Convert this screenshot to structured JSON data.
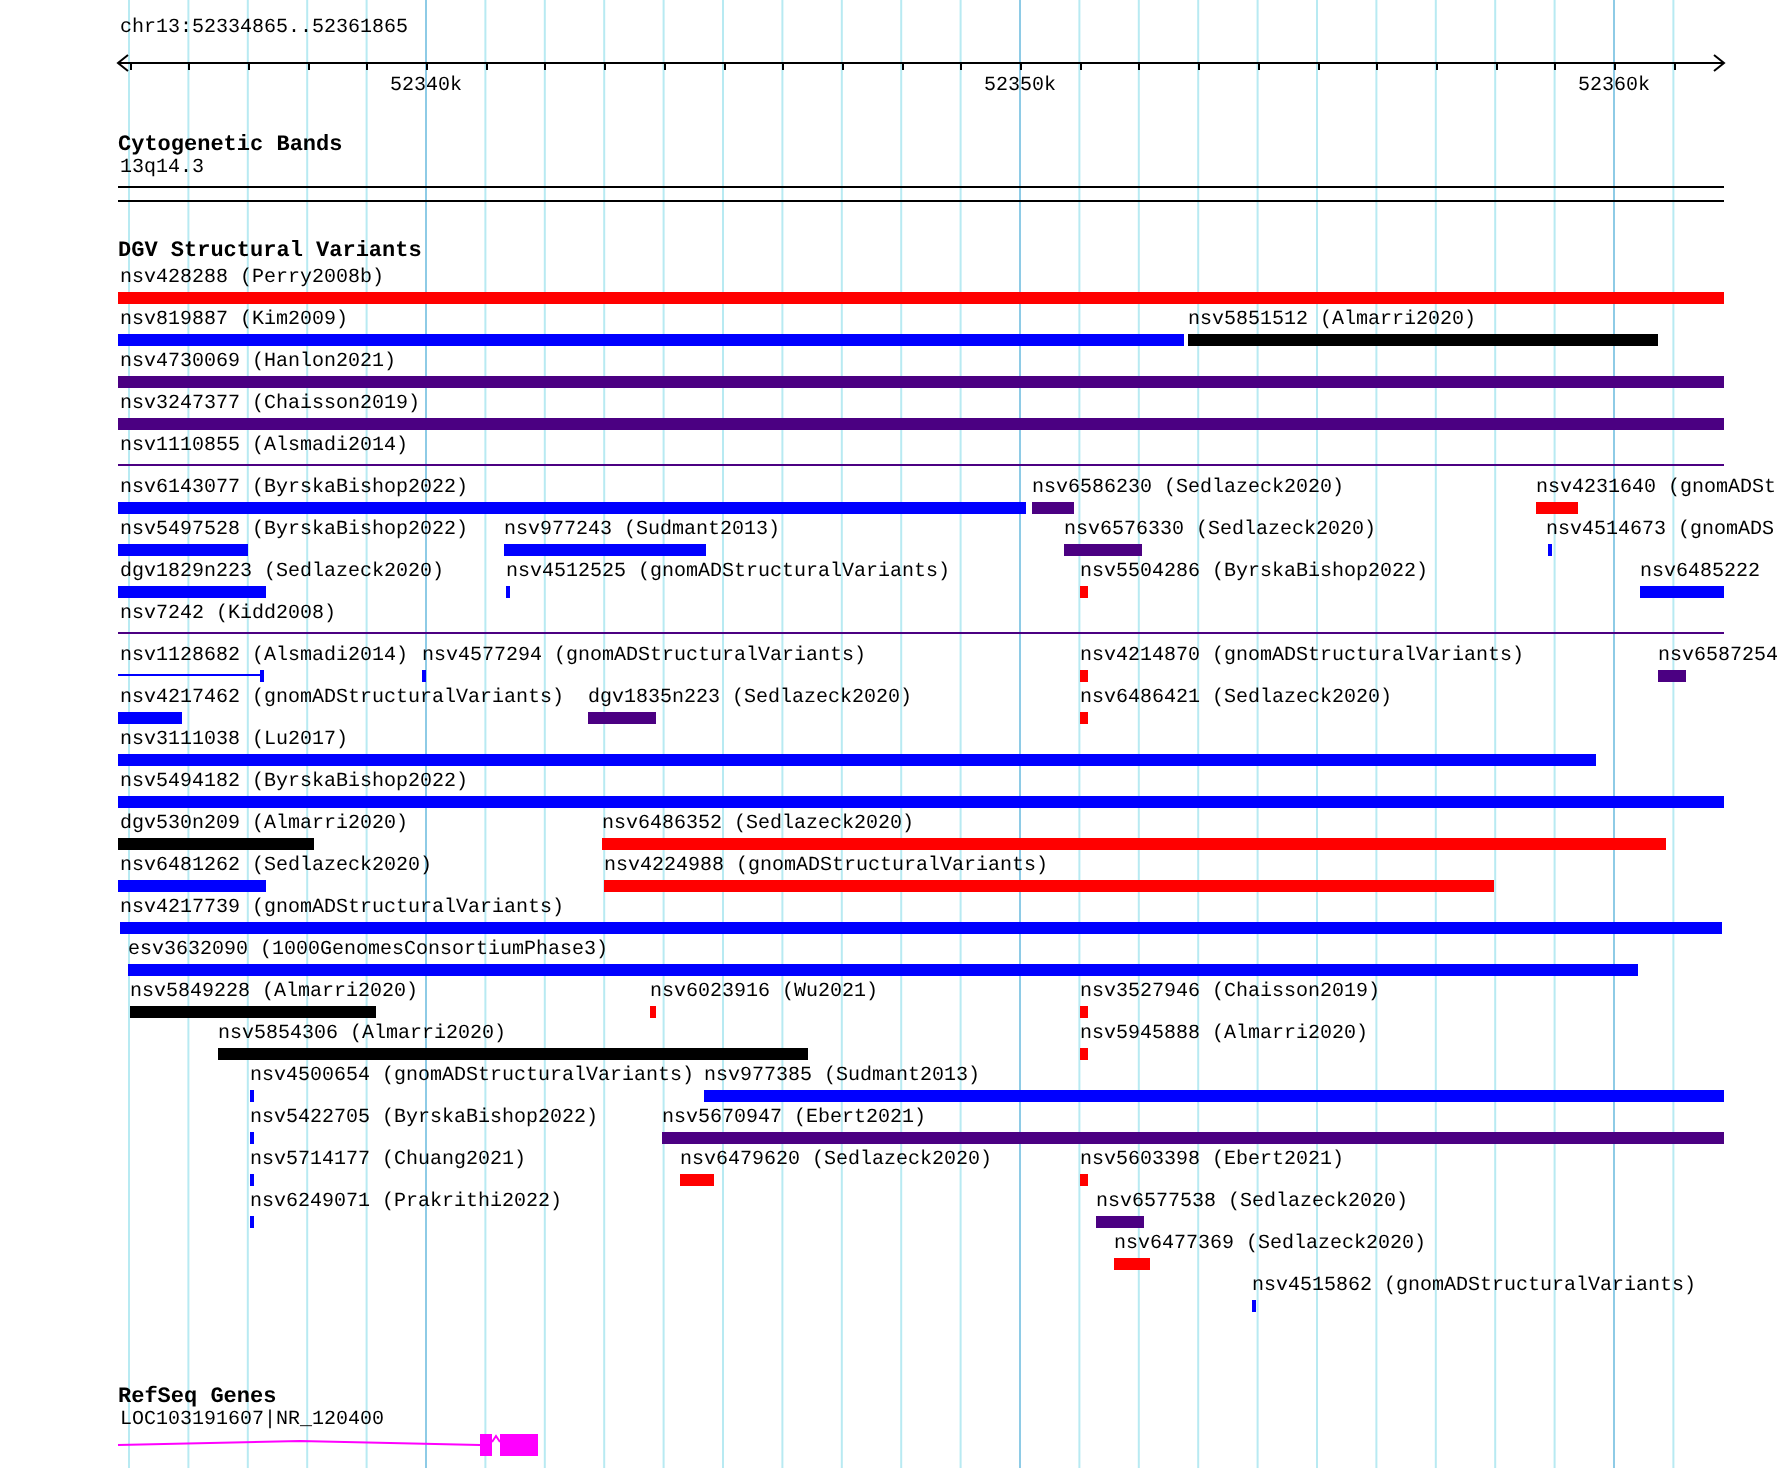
{
  "location": "chr13:52334865..52361865",
  "ruler": {
    "ticks": [
      "52340k",
      "52350k",
      "52360k"
    ]
  },
  "cytogenetic_bands": {
    "title": "Cytogenetic Bands",
    "band": "13q14.3"
  },
  "dgv": {
    "title": "DGV Structural Variants",
    "lanes": [
      {
        "features": [
          {
            "label": "nsv428288 (Perry2008b)",
            "kind": "bar",
            "color": "#ff0000"
          }
        ]
      },
      {
        "features": [
          {
            "label": "nsv819887 (Kim2009)",
            "kind": "bar",
            "color": "#0000ff"
          },
          {
            "label": "nsv5851512 (Almarri2020)",
            "kind": "bar",
            "color": "#000000"
          }
        ]
      },
      {
        "features": [
          {
            "label": "nsv4730069 (Hanlon2021)",
            "kind": "bar",
            "color": "#4b0082"
          }
        ]
      },
      {
        "features": [
          {
            "label": "nsv3247377 (Chaisson2019)",
            "kind": "bar",
            "color": "#4b0082"
          }
        ]
      },
      {
        "features": [
          {
            "label": "nsv1110855 (Alsmadi2014)",
            "kind": "line",
            "color": "#4b0082"
          }
        ]
      },
      {
        "features": [
          {
            "label": "nsv6143077 (ByrskaBishop2022)",
            "kind": "bar",
            "color": "#0000ff"
          },
          {
            "label": "nsv6586230 (Sedlazeck2020)",
            "kind": "bar",
            "color": "#4b0082"
          },
          {
            "label": "nsv4231640 (gnomADSt",
            "kind": "bar",
            "color": "#ff0000"
          }
        ]
      },
      {
        "features": [
          {
            "label": "nsv5497528 (ByrskaBishop2022)",
            "kind": "bar",
            "color": "#0000ff"
          },
          {
            "label": "nsv977243 (Sudmant2013)",
            "kind": "bar",
            "color": "#0000ff"
          },
          {
            "label": "nsv6576330 (Sedlazeck2020)",
            "kind": "bar",
            "color": "#4b0082"
          },
          {
            "label": "nsv4514673 (gnomADS",
            "kind": "bar",
            "color": "#0000ff"
          }
        ]
      },
      {
        "features": [
          {
            "label": "dgv1829n223 (Sedlazeck2020)",
            "kind": "bar",
            "color": "#0000ff"
          },
          {
            "label": "nsv4512525 (gnomADStructuralVariants)",
            "kind": "bar",
            "color": "#0000ff"
          },
          {
            "label": "nsv5504286 (ByrskaBishop2022)",
            "kind": "bar",
            "color": "#ff0000"
          },
          {
            "label": "nsv6485222",
            "kind": "bar",
            "color": "#0000ff"
          }
        ]
      },
      {
        "features": [
          {
            "label": "nsv7242 (Kidd2008)",
            "kind": "line",
            "color": "#4b0082"
          }
        ]
      },
      {
        "features": [
          {
            "label": "nsv1128682 (Alsmadi2014)",
            "kind": "capped",
            "color": "#0000ff"
          },
          {
            "label": "nsv4577294 (gnomADStructuralVariants)",
            "kind": "bar",
            "color": "#0000ff"
          },
          {
            "label": "nsv4214870 (gnomADStructuralVariants)",
            "kind": "bar",
            "color": "#ff0000"
          },
          {
            "label": "nsv6587254",
            "kind": "bar",
            "color": "#4b0082"
          }
        ]
      },
      {
        "features": [
          {
            "label": "nsv4217462 (gnomADStructuralVariants)",
            "kind": "bar",
            "color": "#0000ff"
          },
          {
            "label": "dgv1835n223 (Sedlazeck2020)",
            "kind": "bar",
            "color": "#4b0082"
          },
          {
            "label": "nsv6486421 (Sedlazeck2020)",
            "kind": "bar",
            "color": "#ff0000"
          }
        ]
      },
      {
        "features": [
          {
            "label": "nsv3111038 (Lu2017)",
            "kind": "bar",
            "color": "#0000ff"
          }
        ]
      },
      {
        "features": [
          {
            "label": "nsv5494182 (ByrskaBishop2022)",
            "kind": "bar",
            "color": "#0000ff"
          }
        ]
      },
      {
        "features": [
          {
            "label": "dgv530n209 (Almarri2020)",
            "kind": "bar",
            "color": "#000000"
          },
          {
            "label": "nsv6486352 (Sedlazeck2020)",
            "kind": "bar",
            "color": "#ff0000"
          }
        ]
      },
      {
        "features": [
          {
            "label": "nsv6481262 (Sedlazeck2020)",
            "kind": "bar",
            "color": "#0000ff"
          },
          {
            "label": "nsv4224988 (gnomADStructuralVariants)",
            "kind": "bar",
            "color": "#ff0000"
          }
        ]
      },
      {
        "features": [
          {
            "label": "nsv4217739 (gnomADStructuralVariants)",
            "kind": "bar",
            "color": "#0000ff"
          }
        ]
      },
      {
        "features": [
          {
            "label": "esv3632090 (1000GenomesConsortiumPhase3)",
            "kind": "bar",
            "color": "#0000ff"
          }
        ]
      },
      {
        "features": [
          {
            "label": "nsv5849228 (Almarri2020)",
            "kind": "bar",
            "color": "#000000"
          },
          {
            "label": "nsv6023916 (Wu2021)",
            "kind": "bar",
            "color": "#ff0000"
          },
          {
            "label": "nsv3527946 (Chaisson2019)",
            "kind": "bar",
            "color": "#ff0000"
          }
        ]
      },
      {
        "features": [
          {
            "label": "nsv5854306 (Almarri2020)",
            "kind": "bar",
            "color": "#000000"
          },
          {
            "label": "nsv5945888 (Almarri2020)",
            "kind": "bar",
            "color": "#ff0000"
          }
        ]
      },
      {
        "features": [
          {
            "label": "nsv4500654 (gnomADStructuralVariants)",
            "kind": "bar",
            "color": "#0000ff"
          },
          {
            "label": "nsv977385 (Sudmant2013)",
            "kind": "bar",
            "color": "#0000ff"
          }
        ]
      },
      {
        "features": [
          {
            "label": "nsv5422705 (ByrskaBishop2022)",
            "kind": "bar",
            "color": "#0000ff"
          },
          {
            "label": "nsv5670947 (Ebert2021)",
            "kind": "bar",
            "color": "#4b0082"
          }
        ]
      },
      {
        "features": [
          {
            "label": "nsv5714177 (Chuang2021)",
            "kind": "bar",
            "color": "#0000ff"
          },
          {
            "label": "nsv6479620 (Sedlazeck2020)",
            "kind": "bar",
            "color": "#ff0000"
          },
          {
            "label": "nsv5603398 (Ebert2021)",
            "kind": "bar",
            "color": "#ff0000"
          }
        ]
      },
      {
        "features": [
          {
            "label": "nsv6249071 (Prakrithi2022)",
            "kind": "bar",
            "color": "#0000ff"
          },
          {
            "label": "nsv6577538 (Sedlazeck2020)",
            "kind": "bar",
            "color": "#4b0082"
          }
        ]
      },
      {
        "features": [
          {
            "label": "nsv6477369 (Sedlazeck2020)",
            "kind": "bar",
            "color": "#ff0000"
          }
        ]
      },
      {
        "features": [
          {
            "label": "nsv4515862 (gnomADStructuralVariants)",
            "kind": "bar",
            "color": "#0000ff"
          }
        ]
      }
    ]
  },
  "refseq": {
    "title": "RefSeq Genes",
    "gene": "LOC103191607|NR_120400"
  }
}
